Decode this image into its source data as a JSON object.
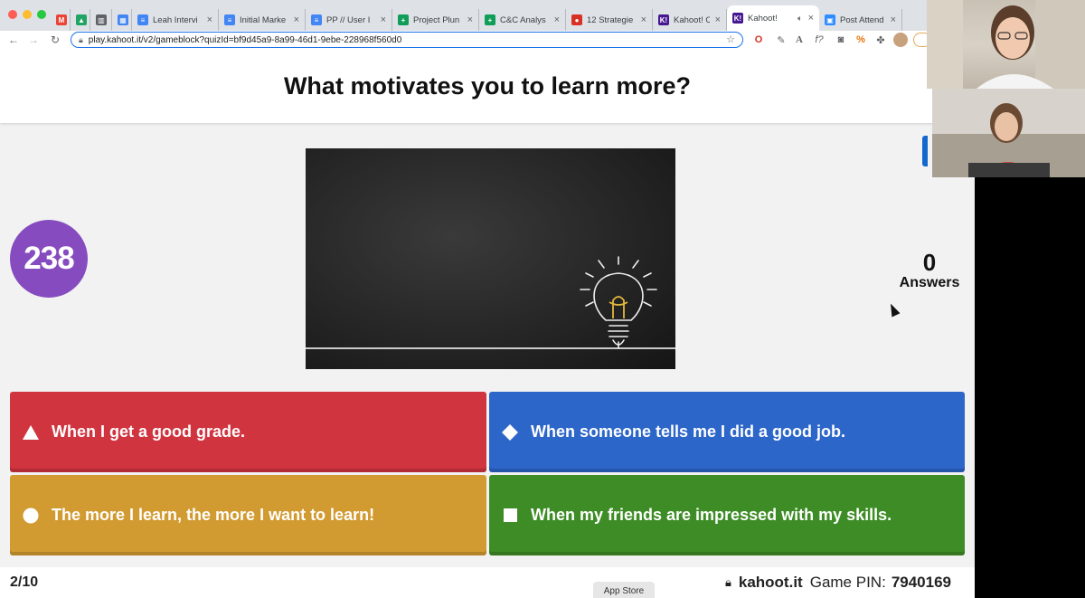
{
  "browser": {
    "tabs": [
      {
        "title": "",
        "icon": "gmail-icon",
        "color": "#ea4335",
        "glyph": "M",
        "active": false
      },
      {
        "title": "",
        "icon": "drive-icon",
        "color": "#1fa463",
        "glyph": "▲",
        "active": false
      },
      {
        "title": "",
        "icon": "panels-icon",
        "color": "#5f6368",
        "glyph": "▥",
        "active": false
      },
      {
        "title": "",
        "icon": "calendar-icon",
        "color": "#4285f4",
        "glyph": "▦",
        "active": false
      },
      {
        "title": "Leah Intervi",
        "icon": "docs-icon",
        "color": "#4285f4",
        "glyph": "≡",
        "active": false
      },
      {
        "title": "Initial Marke",
        "icon": "docs-icon",
        "color": "#4285f4",
        "glyph": "≡",
        "active": false
      },
      {
        "title": "PP // User I",
        "icon": "docs-icon",
        "color": "#4285f4",
        "glyph": "≡",
        "active": false
      },
      {
        "title": "Project Plun",
        "icon": "sheets-icon",
        "color": "#0f9d58",
        "glyph": "+",
        "active": false
      },
      {
        "title": "C&C Analys",
        "icon": "sheets-icon",
        "color": "#0f9d58",
        "glyph": "+",
        "active": false
      },
      {
        "title": "12 Strategie",
        "icon": "strategies-icon",
        "color": "#d93025",
        "glyph": "●",
        "active": false
      },
      {
        "title": "Kahoot! Cre",
        "icon": "kahoot-icon",
        "color": "#46178f",
        "glyph": "K!",
        "active": false
      },
      {
        "title": "Kahoot!",
        "icon": "kahoot-icon",
        "color": "#46178f",
        "glyph": "K!",
        "active": true
      },
      {
        "title": "Post Attend",
        "icon": "zoom-icon",
        "color": "#2d8cff",
        "glyph": "▣",
        "active": false
      }
    ],
    "url": "play.kahoot.it/v2/gameblock?quizId=bf9d45a9-8a99-46d1-9ebe-228968f560d0"
  },
  "question": {
    "title": "What motivates you to learn more?",
    "timer": "238",
    "answers_count": "0",
    "answers_label": "Answers"
  },
  "answers": [
    {
      "text": "When I get a good grade.",
      "shape": "triangle-icon",
      "color": "#d0343f"
    },
    {
      "text": "When someone tells me I did a good job.",
      "shape": "diamond-icon",
      "color": "#2d66c9"
    },
    {
      "text": "The more I learn, the more I want to learn!",
      "shape": "circle-icon",
      "color": "#d29b31"
    },
    {
      "text": "When my friends are impressed with my skills.",
      "shape": "square-icon",
      "color": "#3e8c26"
    }
  ],
  "footer": {
    "progress": "2/10",
    "brand": "kahoot.it",
    "pin_label": "Game PIN:",
    "pin": "7940169",
    "app_store": "App Store"
  }
}
